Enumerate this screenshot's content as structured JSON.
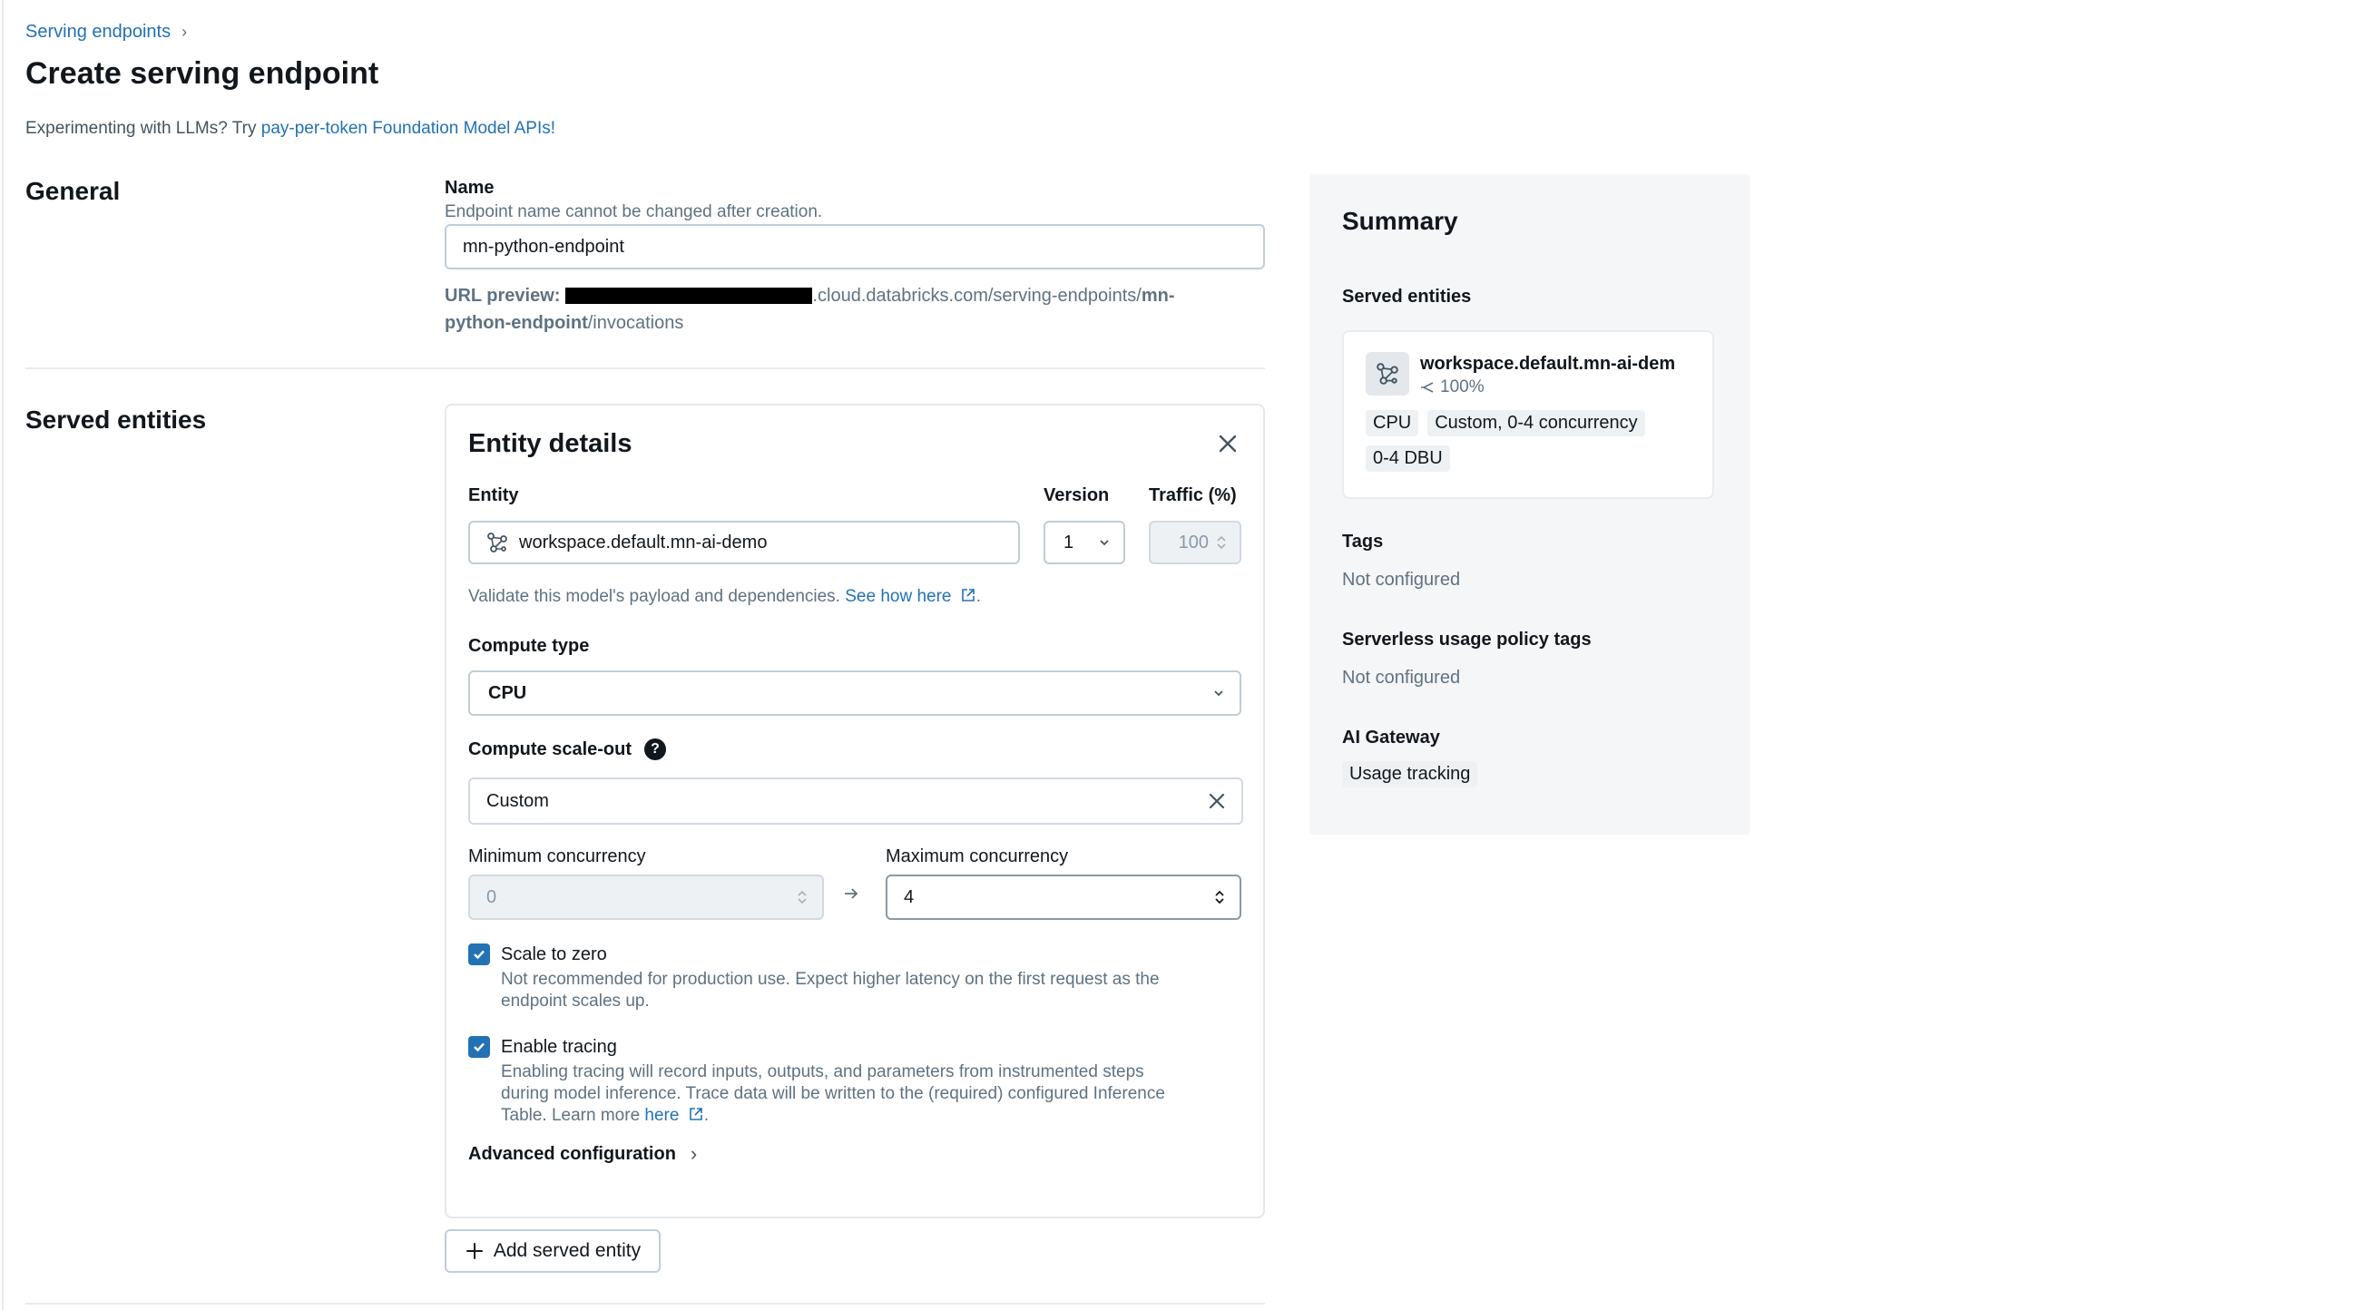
{
  "breadcrumb": {
    "label": "Serving endpoints"
  },
  "page": {
    "title": "Create serving endpoint"
  },
  "notice": {
    "prefix": "Experimenting with LLMs? Try ",
    "link": "pay-per-token Foundation Model APIs!"
  },
  "general": {
    "title": "General",
    "name_label": "Name",
    "name_hint": "Endpoint name cannot be changed after creation.",
    "name_value": "mn-python-endpoint",
    "url_label": "URL preview:",
    "url_middle": ".cloud.databricks.com/serving-endpoints/",
    "url_name_bold_1": "mn-",
    "url_name_bold_2": "python-endpoint",
    "url_suffix": "/invocations"
  },
  "served_entities": {
    "title": "Served entities",
    "card_title": "Entity details",
    "entity_label": "Entity",
    "entity_value": "workspace.default.mn-ai-demo",
    "version_label": "Version",
    "version_value": "1",
    "traffic_label": "Traffic (%)",
    "traffic_value": "100",
    "validate_text": "Validate this model's payload and dependencies. ",
    "validate_link": "See how here",
    "compute_type_label": "Compute type",
    "compute_type_value": "CPU",
    "scaleout_label": "Compute scale-out",
    "scaleout_value": "Custom",
    "min_label": "Minimum concurrency",
    "min_value": "0",
    "max_label": "Maximum concurrency",
    "max_value": "4",
    "scale_zero_label": "Scale to zero",
    "scale_zero_checked": true,
    "scale_zero_desc_1": "Not recommended for production use. Expect higher latency on the first request as the",
    "scale_zero_desc_2": "endpoint scales up.",
    "tracing_label": "Enable tracing",
    "tracing_checked": true,
    "tracing_desc_1": "Enabling tracing will record inputs, outputs, and parameters from instrumented steps",
    "tracing_desc_2": "during model inference. Trace data will be written to the (required) configured Inference",
    "tracing_desc_3": "Table. Learn more ",
    "tracing_link": "here",
    "advanced_label": "Advanced configuration",
    "add_button": "Add served entity"
  },
  "summary": {
    "title": "Summary",
    "served_label": "Served entities",
    "entity_name": "workspace.default.mn-ai-dem",
    "entity_traffic": "100%",
    "tags": [
      "CPU",
      "Custom, 0-4 concurrency",
      "0-4 DBU"
    ],
    "tags_label": "Tags",
    "tags_value": "Not configured",
    "policy_label": "Serverless usage policy tags",
    "policy_value": "Not configured",
    "gateway_label": "AI Gateway",
    "gateway_tag": "Usage tracking"
  },
  "colors": {
    "link": "#2272b4",
    "checkbox": "#2272b4",
    "text": "#11171c"
  }
}
